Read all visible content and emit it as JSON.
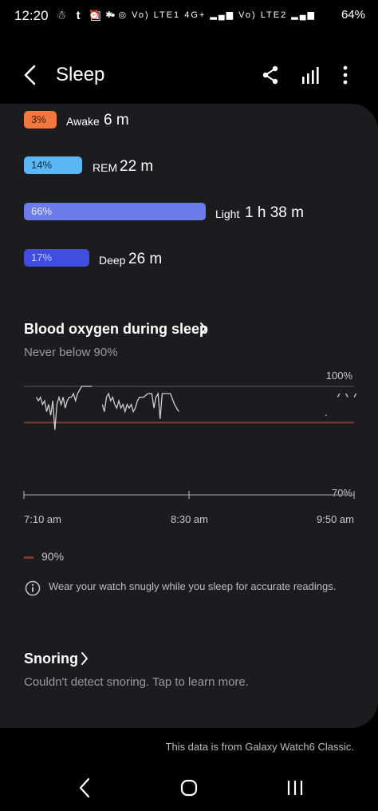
{
  "status_bar": {
    "time": "12:20",
    "left_icons": [
      "notification-icon",
      "tumblr-icon",
      "calendar-icon",
      "dot-icon"
    ],
    "right_icons": [
      "alarm-icon",
      "bluetooth-icon",
      "hotspot-icon",
      "volte-icon",
      "signal-icon"
    ],
    "network_1": "Vo) LTE1",
    "network_2": "Vo) LTE2",
    "network_type": "4G+",
    "battery": "64%"
  },
  "header": {
    "title": "Sleep",
    "icons": [
      "back-arrow-icon",
      "share-icon",
      "bar-chart-icon",
      "more-vert-icon"
    ]
  },
  "sleep_stages": [
    {
      "percent": "3%",
      "label": "Awake",
      "value": "6 m",
      "color": "#f2783f",
      "fraction": 0.03
    },
    {
      "percent": "14%",
      "label": "REM",
      "value": "22 m",
      "color": "#5bb6f1",
      "fraction": 0.14
    },
    {
      "percent": "66%",
      "label": "Light",
      "value": "1 h 38 m",
      "color": "#6c7de9",
      "fraction": 0.66
    },
    {
      "percent": "17%",
      "label": "Deep",
      "value": "26 m",
      "color": "#3f4de0",
      "fraction": 0.17
    }
  ],
  "blood_oxygen": {
    "title": "Blood oxygen during sleep",
    "subtitle": "Never below 90%",
    "legend": "90%",
    "info": "Wear your watch snugly while you sleep for accurate readings."
  },
  "chart_data": {
    "type": "line",
    "y_max_label": "100%",
    "y_min_label": "70%",
    "ylim": [
      70,
      100
    ],
    "threshold": 90,
    "threshold_color": "#7a3a32",
    "x_ticks": [
      "7:10 am",
      "8:30 am",
      "9:50 am"
    ],
    "x_minutes": [
      0,
      80,
      160
    ],
    "series": [
      {
        "points": [
          [
            6,
            97
          ],
          [
            7,
            96
          ],
          [
            8,
            97
          ],
          [
            9,
            95
          ],
          [
            10,
            96
          ],
          [
            11,
            93
          ],
          [
            12,
            95
          ],
          [
            13,
            92
          ],
          [
            14,
            96
          ],
          [
            15,
            88
          ],
          [
            16,
            95
          ],
          [
            17,
            97
          ],
          [
            18,
            95
          ],
          [
            19,
            97
          ],
          [
            20,
            94
          ],
          [
            21,
            96
          ],
          [
            22,
            97
          ],
          [
            23,
            97
          ],
          [
            24,
            98
          ],
          [
            25,
            96
          ],
          [
            26,
            98
          ],
          [
            27,
            99
          ],
          [
            28,
            100
          ],
          [
            29,
            100
          ],
          [
            31,
            100
          ],
          [
            33,
            100
          ]
        ]
      },
      {
        "points": [
          [
            38,
            95
          ],
          [
            39,
            93
          ],
          [
            40,
            97
          ],
          [
            41,
            98
          ],
          [
            42,
            96
          ],
          [
            43,
            97
          ],
          [
            44,
            95
          ],
          [
            45,
            94
          ],
          [
            46,
            96
          ],
          [
            47,
            94
          ],
          [
            48,
            95
          ],
          [
            49,
            93
          ],
          [
            50,
            95
          ],
          [
            51,
            94
          ],
          [
            52,
            95
          ],
          [
            53,
            93
          ],
          [
            54,
            94
          ],
          [
            55,
            96
          ],
          [
            56,
            97
          ],
          [
            58,
            97
          ],
          [
            60,
            98
          ],
          [
            62,
            98
          ],
          [
            63,
            94
          ],
          [
            64,
            97
          ],
          [
            65,
            98
          ],
          [
            66,
            91
          ],
          [
            67,
            98
          ],
          [
            69,
            98
          ],
          [
            71,
            98
          ],
          [
            73,
            95
          ],
          [
            75,
            93
          ]
        ]
      },
      {
        "points": [
          [
            152,
            97
          ],
          [
            153,
            98
          ]
        ]
      },
      {
        "points": [
          [
            156,
            98
          ],
          [
            157,
            97
          ]
        ]
      },
      {
        "points": [
          [
            160,
            97
          ],
          [
            161,
            98
          ]
        ]
      },
      {
        "points": [
          [
            146,
            92
          ],
          [
            146.6,
            92
          ]
        ]
      }
    ],
    "grid": false
  },
  "snoring": {
    "title": "Snoring",
    "subtitle": "Couldn't detect snoring. Tap to learn more."
  },
  "footnote": "This data is from Galaxy Watch6 Classic.",
  "nav_bar": {
    "icons": [
      "back-nav-icon",
      "home-nav-icon",
      "recents-nav-icon"
    ]
  }
}
